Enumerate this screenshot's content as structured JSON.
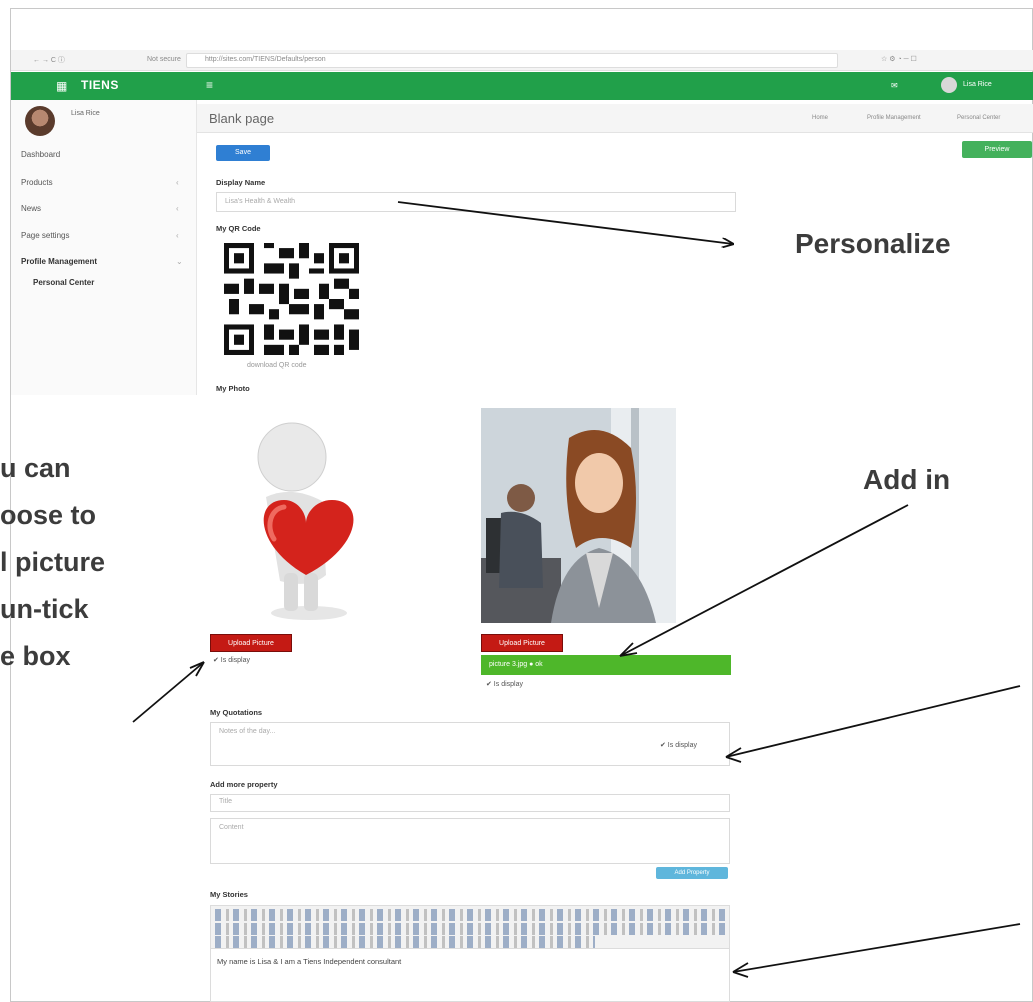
{
  "browser": {
    "nav_icons": "←  →  C  ⓘ",
    "security": "Not secure",
    "url": "http://sites.com/TIENS/Defaults/person",
    "right_icons": "☆  ⚙  ◔  ─  ☐"
  },
  "topnav": {
    "brand": "TIENS",
    "menu_icon": "≡",
    "user_name": "Lisa Rice"
  },
  "sidebar": {
    "user_name": "Lisa Rice",
    "items": [
      {
        "label": "Dashboard"
      },
      {
        "label": "Products"
      },
      {
        "label": "News"
      },
      {
        "label": "Page settings"
      },
      {
        "label": "Profile Management"
      },
      {
        "label": "Personal Center"
      }
    ]
  },
  "page": {
    "title": "Blank page",
    "breadcrumb": [
      "Home",
      "Profile Management",
      "Personal Center"
    ],
    "save_label": "Save",
    "preview_label": "Preview",
    "display_name_label": "Display Name",
    "display_name_value": "Lisa's Health & Wealth",
    "qr_label": "My QR Code",
    "qr_caption": "download QR code",
    "photo_label": "My Photo",
    "upload_label": "Upload Picture",
    "upload_label_2": "Upload Picture",
    "display_check": "✔ Is display",
    "display_check_2": "✔ Is display",
    "uploaded_file": "picture 3.jpg   ● ok",
    "quotations_label": "My Quotations",
    "quotations_placeholder": "Notes of the day...",
    "quotations_check": "✔ Is display",
    "more_property_label": "Add more property",
    "property_title_placeholder": "Title",
    "property_content_placeholder": "Content",
    "add_property_label": "Add Property",
    "stories_label": "My Stories",
    "stories_text": "My name is Lisa & I am a Tiens Independent consultant"
  },
  "annotations": {
    "right_1": "Personalize",
    "right_2": "Add in",
    "left_lines": [
      "u can",
      "oose to",
      "l picture",
      "un-tick",
      "e box"
    ]
  },
  "colors": {
    "green": "#21a04a",
    "upload_red": "#c41a14",
    "primary_blue": "#2f7fd3"
  }
}
